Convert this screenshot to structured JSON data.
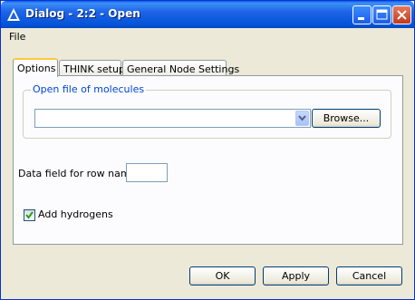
{
  "window": {
    "title": "Dialog - 2:2 - Open"
  },
  "menu": {
    "items": [
      "File"
    ]
  },
  "tabs": [
    {
      "label": "Options",
      "active": true
    },
    {
      "label": "THINK setup",
      "active": false
    },
    {
      "label": "General Node Settings",
      "active": false
    }
  ],
  "options": {
    "file_group_title": "Open file of molecules",
    "file_value": "",
    "browse_label": "Browse...",
    "row_name_label": "Data field for row name",
    "row_name_value": "",
    "add_hydrogens_label": "Add hydrogens",
    "add_hydrogens_checked": true
  },
  "buttons": {
    "ok": "OK",
    "apply": "Apply",
    "cancel": "Cancel"
  },
  "colors": {
    "titlebar": "#0553d8",
    "group_title": "#0046d5",
    "active_tab_accent": "#ffc83c",
    "checkmark": "#21a121"
  },
  "icons": {
    "app": "app-triangle-icon",
    "minimize": "minimize-icon",
    "maximize": "maximize-icon",
    "close": "close-icon",
    "dropdown": "chevron-down-icon",
    "check": "checkmark-icon"
  }
}
